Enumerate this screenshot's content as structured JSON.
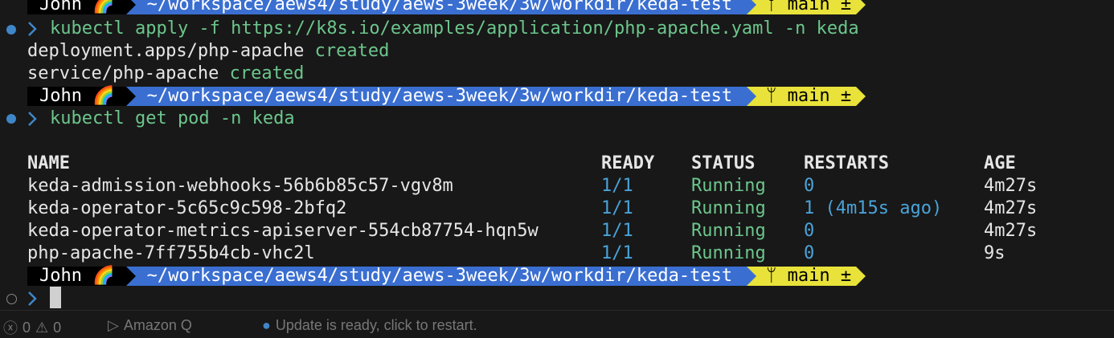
{
  "prompt": {
    "user": "John",
    "user_icon": "rainbow-icon",
    "path": "~/workspace/aews4/study/aews-3week/3w/workdir/keda-test",
    "git_icon": "git-branch-icon",
    "branch": "main",
    "branch_status": "±",
    "colors": {
      "user_bg": "#000000",
      "path_bg": "#3a6fd1",
      "git_bg": "#e8e23a"
    }
  },
  "commands": [
    {
      "text": "kubectl apply -f https://k8s.io/examples/application/php-apache.yaml -n keda"
    },
    {
      "text": "kubectl get pod -n keda"
    }
  ],
  "apply_output": [
    {
      "resource": "deployment.apps/php-apache",
      "status": "created"
    },
    {
      "resource": "service/php-apache",
      "status": "created"
    }
  ],
  "pods_table": {
    "headers": {
      "name": "NAME",
      "ready": "READY",
      "status": "STATUS",
      "restarts": "RESTARTS",
      "age": "AGE"
    },
    "rows": [
      {
        "name": "keda-admission-webhooks-56b6b85c57-vgv8m",
        "ready": "1/1",
        "status": "Running",
        "restarts": "0",
        "age": "4m27s"
      },
      {
        "name": "keda-operator-5c65c9c598-2bfq2",
        "ready": "1/1",
        "status": "Running",
        "restarts": "1 (4m15s ago)",
        "age": "4m27s"
      },
      {
        "name": "keda-operator-metrics-apiserver-554cb87754-hqn5w",
        "ready": "1/1",
        "status": "Running",
        "restarts": "0",
        "age": "4m27s"
      },
      {
        "name": "php-apache-7ff755b4cb-vhc2l",
        "ready": "1/1",
        "status": "Running",
        "restarts": "0",
        "age": "9s"
      }
    ]
  },
  "statusbar": {
    "errors": "0",
    "warnings": "0",
    "amazon_q": "Amazon Q",
    "update": "Update is ready, click to restart."
  }
}
